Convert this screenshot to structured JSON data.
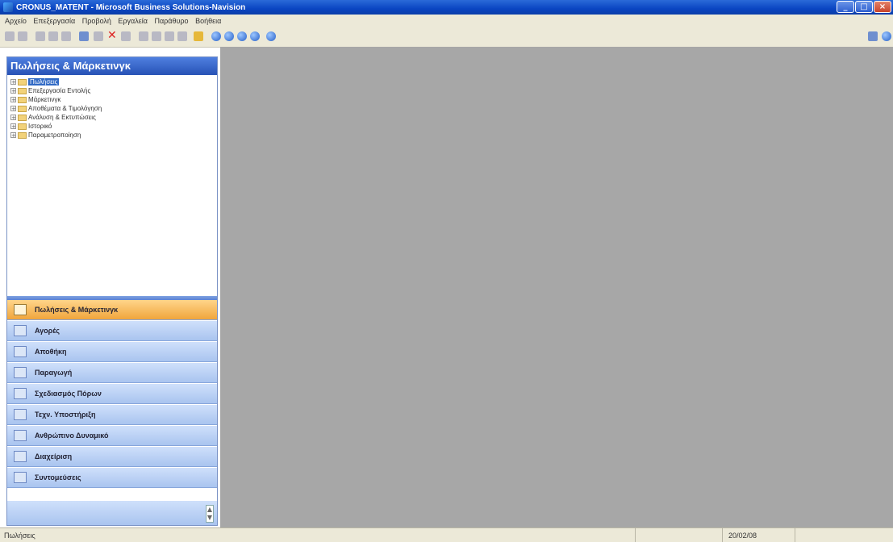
{
  "window": {
    "title": "CRONUS_MATENT - Microsoft Business Solutions-Navision"
  },
  "menubar": {
    "items": [
      "Αρχείο",
      "Επεξεργασία",
      "Προβολή",
      "Εργαλεία",
      "Παράθυρο",
      "Βοήθεια"
    ]
  },
  "toolbar": {
    "icons": [
      "new-icon",
      "save-icon",
      "cut-icon",
      "copy-icon",
      "paste-icon",
      "undo-icon",
      "find-icon",
      "delete-icon",
      "search-icon",
      "list-icon",
      "card-icon",
      "report-icon",
      "sort-icon",
      "user-icon",
      "nav-first-icon",
      "nav-prev-icon",
      "nav-next-icon",
      "nav-last-icon",
      "help-icon"
    ]
  },
  "navpane": {
    "title": "Πωλήσεις & Μάρκετινγκ",
    "tree": [
      "Πωλήσεις",
      "Επεξεργασία Εντολής",
      "Μάρκετινγκ",
      "Αποθέματα & Τιμολόγηση",
      "Ανάλυση & Εκτυπώσεις",
      "Ιστορικό",
      "Παραμετροποίηση"
    ],
    "buttons": [
      "Πωλήσεις & Μάρκετινγκ",
      "Αγορές",
      "Αποθήκη",
      "Παραγωγή",
      "Σχεδιασμός Πόρων",
      "Τεχν. Υποστήριξη",
      "Ανθρώπινο Δυναμικό",
      "Διαχείριση",
      "Συντομεύσεις"
    ]
  },
  "statusbar": {
    "left": "Πωλήσεις",
    "date": "20/02/08"
  },
  "colors": {
    "title_bar": "#0a45c2",
    "nav_header": "#2752b5",
    "active_button": "#f0a53c",
    "workspace": "#a7a7a7"
  }
}
